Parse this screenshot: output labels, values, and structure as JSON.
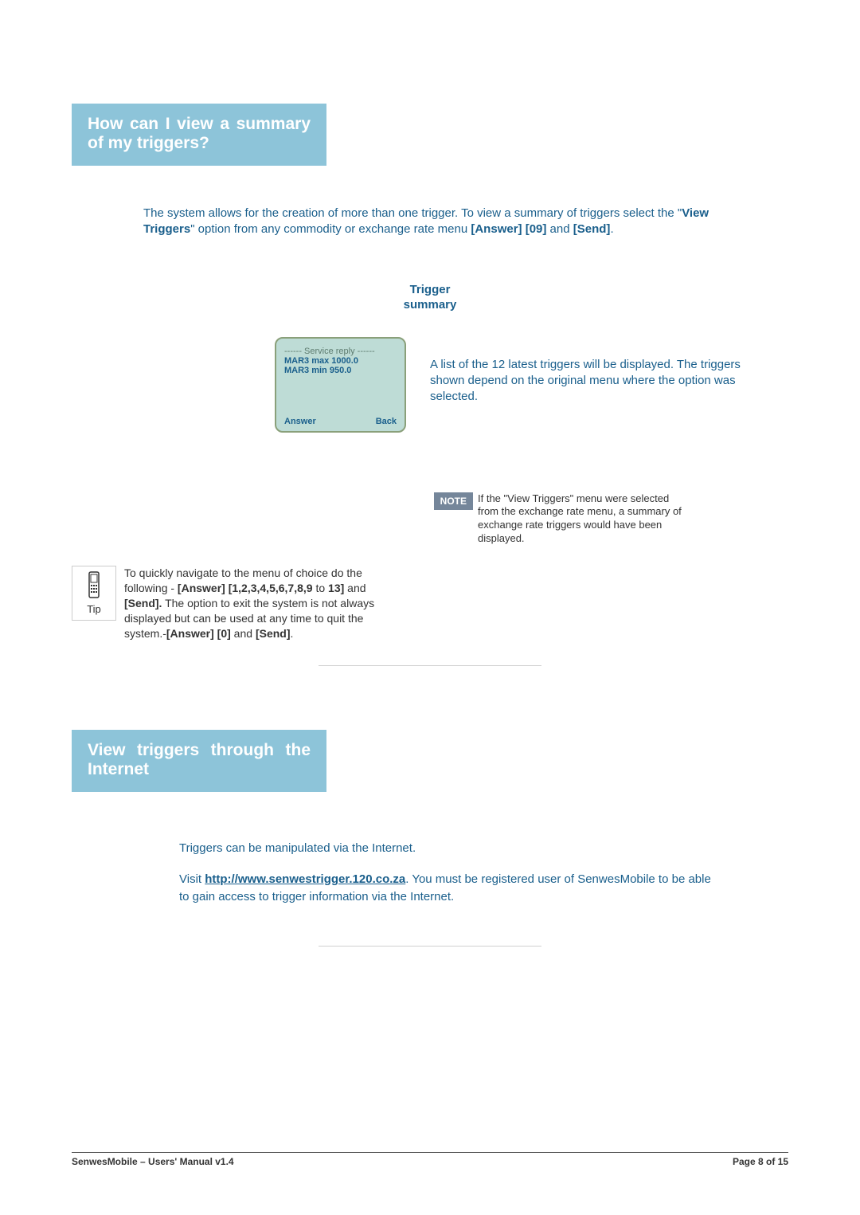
{
  "heading1": "How can I view a summary of my triggers?",
  "intro": {
    "p1a": "The system allows for the creation of more than one trigger. To view a summary of triggers select the \"",
    "p1bold1": "View Triggers",
    "p1b": "\" option from any commodity or exchange rate menu ",
    "p1bold2": "[Answer] [09]",
    "p1c": " and ",
    "p1bold3": "[Send]",
    "p1d": "."
  },
  "trigger_title_l1": "Trigger",
  "trigger_title_l2": "summary",
  "screen": {
    "header": "------ Service reply ------",
    "line1": "MAR3 max 1000.0",
    "line2": "MAR3 min 950.0",
    "answer": "Answer",
    "back": "Back"
  },
  "screen_desc": "A list of the 12 latest triggers will be displayed. The triggers shown depend on the original menu where the option was selected.",
  "note_label": "NOTE",
  "note_text": "If the \"View Triggers\" menu were selected from the exchange rate menu, a summary of exchange rate triggers would have been displayed.",
  "tip_label": "Tip",
  "tip": {
    "t1": "To quickly navigate to the menu of choice do the following - ",
    "b1": "[Answer] [1,2,3,4,5,6,7,8,9",
    "t2": " to ",
    "b2": "13]",
    "t3": " and ",
    "b3": "[Send].",
    "t4": " The option to exit the system is not always displayed but can be used at any time to quit the system.-",
    "b4": "[Answer] [0]",
    "t5": " and ",
    "b5": "[Send]",
    "t6": "."
  },
  "heading2": "View triggers through the Internet",
  "intro2_p1": "Triggers can be manipulated via the Internet.",
  "intro2_p2a": "Visit ",
  "intro2_link": "http://www.senwestrigger.120.co.za",
  "intro2_p2b": ". You must be registered user of SenwesMobile to be able to gain access to trigger information via the Internet.",
  "footer_left": "SenwesMobile – Users' Manual v1.4",
  "footer_right": "Page 8 of 15"
}
